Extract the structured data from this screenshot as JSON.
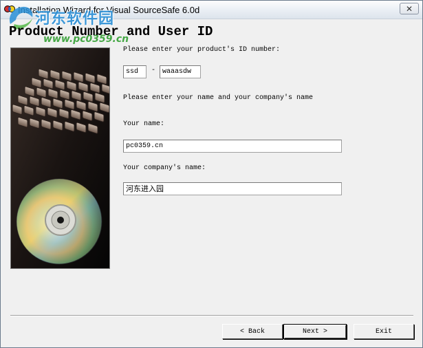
{
  "window": {
    "title": "Installation Wizard for Visual SourceSafe 6.0d",
    "close_glyph": "✕"
  },
  "watermark": {
    "site_name": "河东软件园",
    "site_url": "www.pc0359.cn"
  },
  "page": {
    "title": "Product Number and User ID"
  },
  "form": {
    "product_id_prompt": "Please enter your product's ID number:",
    "product_id_part1": "ssd",
    "product_id_separator": "-",
    "product_id_part2": "waaasdw",
    "name_company_prompt": "Please enter your name and your company's name",
    "name_label": "Your name:",
    "name_value": "pc0359.cn",
    "company_label": "Your company's name:",
    "company_value": "河东进入园"
  },
  "buttons": {
    "back": "< Back",
    "next": "Next >",
    "exit": "Exit"
  },
  "icons": {
    "app": "sourcesafe-icon",
    "close": "close-icon",
    "image": "cd-keyboard-illustration"
  }
}
